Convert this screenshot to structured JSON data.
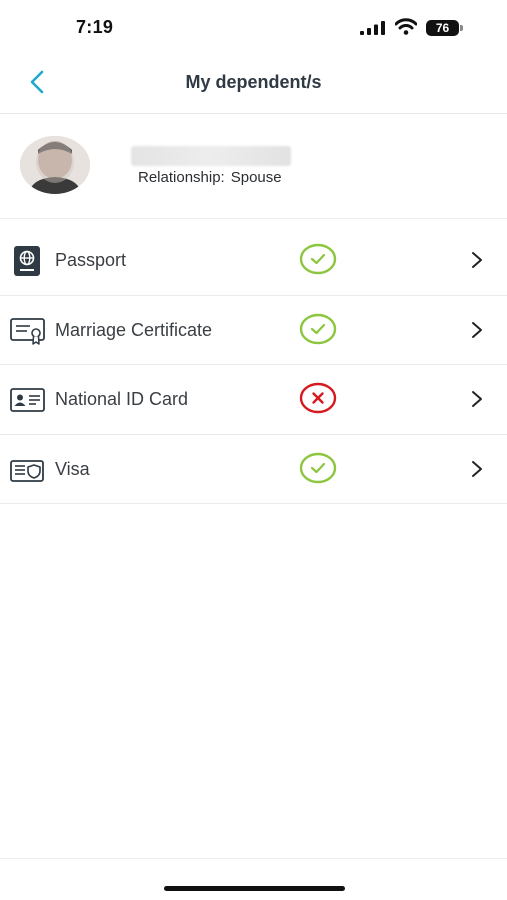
{
  "status_bar": {
    "time": "7:19",
    "battery_level": "76"
  },
  "header": {
    "title": "My dependent/s",
    "back_icon": "chevron-left-icon",
    "accent_color": "#1fa8c9"
  },
  "dependent": {
    "relationship_label": "Relationship:",
    "relationship_value": "Spouse"
  },
  "documents": [
    {
      "label": "Passport",
      "icon": "passport-icon",
      "status": "complete"
    },
    {
      "label": "Marriage Certificate",
      "icon": "certificate-icon",
      "status": "complete"
    },
    {
      "label": "National ID Card",
      "icon": "id-card-icon",
      "status": "missing"
    },
    {
      "label": "Visa",
      "icon": "visa-icon",
      "status": "complete"
    }
  ],
  "status_colors": {
    "complete": "#8cc63f",
    "missing": "#d71920"
  }
}
